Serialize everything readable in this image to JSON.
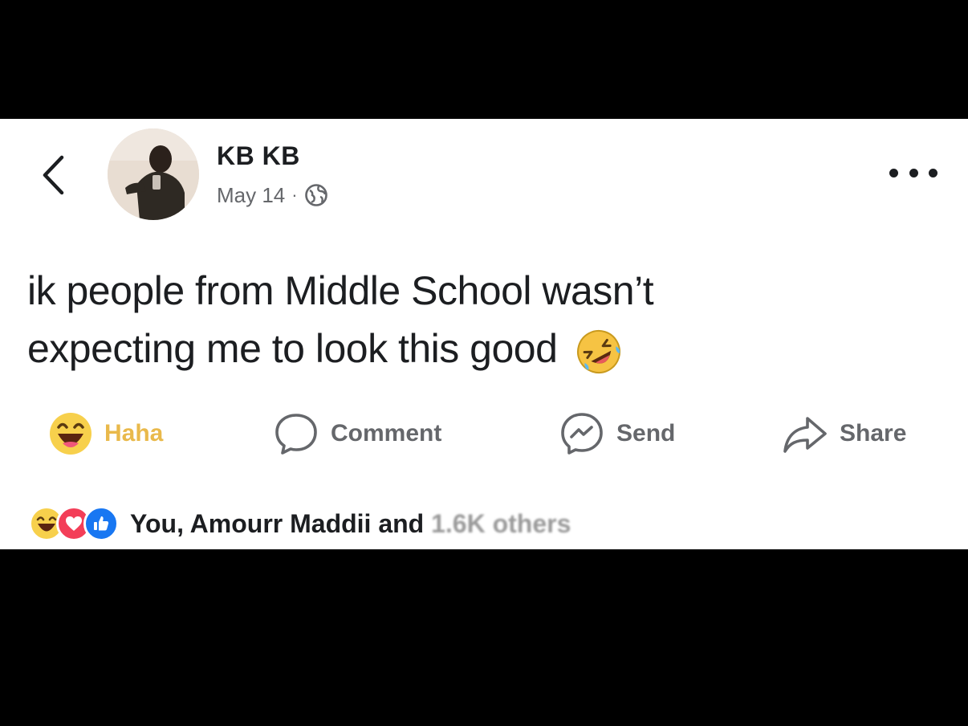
{
  "post": {
    "author": "KB KB",
    "date": "May 14",
    "separator": "·",
    "privacy_icon": "globe-icon",
    "text_line1": "ik people from Middle School wasn’t",
    "text_line2": "expecting me to look this good",
    "text_emoji": "rolling-on-floor-laughing-emoji"
  },
  "header": {
    "back_icon": "chevron-left-icon",
    "more_icon": "more-dots-icon"
  },
  "actions": {
    "haha_label": "Haha",
    "comment_label": "Comment",
    "send_label": "Send",
    "share_label": "Share"
  },
  "reactions": {
    "icons": [
      "haha-reaction-icon",
      "love-reaction-icon",
      "like-reaction-icon"
    ],
    "text": "You, Amourr Maddii and ",
    "others_text": "1.6K others"
  },
  "colors": {
    "text_primary": "#1c1e21",
    "text_secondary": "#65676b",
    "haha_yellow": "#e9b94b",
    "like_blue": "#1877f2",
    "love_red": "#f33e58",
    "letterbox": "#000000"
  }
}
